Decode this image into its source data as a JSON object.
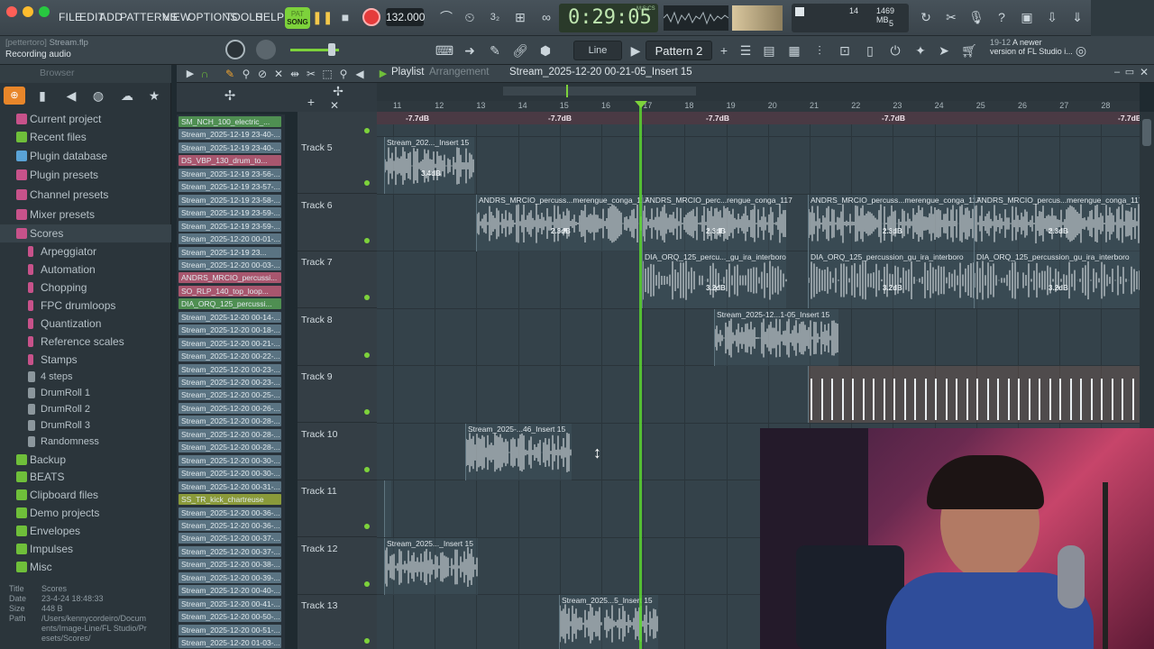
{
  "menu": [
    "FILE",
    "EDIT",
    "ADD",
    "PATTERNS",
    "VIEW",
    "OPTIONS",
    "TOOLS",
    "HELP"
  ],
  "transport": {
    "song_label": "SONG",
    "pat_label": "PAT",
    "tempo": "132.000",
    "time": "0:29:05",
    "time_units": "M:S:CS",
    "cpu_num": "14",
    "mem": "1469 MB",
    "mem_sub": "5"
  },
  "project": {
    "name": "Stream.flp",
    "owner": "[pettertoro]",
    "status": "Recording audio"
  },
  "toolbar2": {
    "snap": "Line",
    "pattern": "Pattern 2",
    "news_date": "19-12",
    "news_text": "A newer",
    "news_text2": "version of FL Studio i..."
  },
  "browser": {
    "title": "Browser",
    "items": [
      {
        "label": "Current project",
        "color": "#c7528a"
      },
      {
        "label": "Recent files",
        "color": "#6fbf3a"
      },
      {
        "label": "Plugin database",
        "color": "#5aa3d6"
      },
      {
        "label": "Plugin presets",
        "color": "#c7528a"
      },
      {
        "label": "Channel presets",
        "color": "#c7528a"
      },
      {
        "label": "Mixer presets",
        "color": "#c7528a"
      },
      {
        "label": "Scores",
        "color": "#c7528a"
      }
    ],
    "subitems": [
      "Arpeggiator",
      "Automation",
      "Chopping",
      "FPC drumloops",
      "Quantization",
      "Reference scales",
      "Stamps",
      "4 steps",
      "DrumRoll 1",
      "DrumRoll 2",
      "DrumRoll 3",
      "Randomness"
    ],
    "items2": [
      {
        "label": "Backup",
        "color": "#6fbf3a"
      },
      {
        "label": "BEATS",
        "color": "#6fbf3a"
      },
      {
        "label": "Clipboard files",
        "color": "#6fbf3a"
      },
      {
        "label": "Demo projects",
        "color": "#6fbf3a"
      },
      {
        "label": "Envelopes",
        "color": "#6fbf3a"
      },
      {
        "label": "Impulses",
        "color": "#6fbf3a"
      },
      {
        "label": "Misc",
        "color": "#6fbf3a"
      }
    ],
    "info": {
      "title_label": "Title",
      "title": "Scores",
      "date_label": "Date",
      "date": "23-4-24 18:48:33",
      "size_label": "Size",
      "size": "448 B",
      "path_label": "Path",
      "path": "/Users/kennycordeiro/Documents/Image-Line/FL Studio/Presets/Scores/"
    }
  },
  "channels": [
    {
      "name": "SM_NCH_100_electric_...",
      "color": "#4f8f52"
    },
    {
      "name": "Stream_2025-12-19 23-40-...",
      "color": "#5a7382"
    },
    {
      "name": "Stream_2025-12-19 23-40-...",
      "color": "#5a7382"
    },
    {
      "name": "DS_VBP_130_drum_to...",
      "color": "#a8566e"
    },
    {
      "name": "Stream_2025-12-19 23-56-...",
      "color": "#5a7382"
    },
    {
      "name": "Stream_2025-12-19 23-57-...",
      "color": "#5a7382"
    },
    {
      "name": "Stream_2025-12-19 23-58-...",
      "color": "#5a7382"
    },
    {
      "name": "Stream_2025-12-19 23-59-...",
      "color": "#5a7382"
    },
    {
      "name": "Stream_2025-12-19 23-59-...",
      "color": "#5a7382"
    },
    {
      "name": "Stream_2025-12-20 00-01-...",
      "color": "#5a7382"
    },
    {
      "name": "Stream_2025-12-19 23...",
      "color": "#5a7382"
    },
    {
      "name": "Stream_2025-12-20 00-03-...",
      "color": "#5a7382"
    },
    {
      "name": "ANDRS_MRCIO_percussi...",
      "color": "#a8566e"
    },
    {
      "name": "SO_RLP_140_top_loop...",
      "color": "#a8566e"
    },
    {
      "name": "DIA_ORQ_125_percussi...",
      "color": "#4f8f52"
    },
    {
      "name": "Stream_2025-12-20 00-14-...",
      "color": "#5a7382"
    },
    {
      "name": "Stream_2025-12-20 00-18-...",
      "color": "#5a7382"
    },
    {
      "name": "Stream_2025-12-20 00-21-...",
      "color": "#5a7382"
    },
    {
      "name": "Stream_2025-12-20 00-22-...",
      "color": "#5a7382"
    },
    {
      "name": "Stream_2025-12-20 00-23-...",
      "color": "#5a7382"
    },
    {
      "name": "Stream_2025-12-20 00-23-...",
      "color": "#5a7382"
    },
    {
      "name": "Stream_2025-12-20 00-25-...",
      "color": "#5a7382"
    },
    {
      "name": "Stream_2025-12-20 00-26-...",
      "color": "#5a7382"
    },
    {
      "name": "Stream_2025-12-20 00-28-...",
      "color": "#5a7382"
    },
    {
      "name": "Stream_2025-12-20 00-28-...",
      "color": "#5a7382"
    },
    {
      "name": "Stream_2025-12-20 00-28-...",
      "color": "#5a7382"
    },
    {
      "name": "Stream_2025-12-20 00-30-...",
      "color": "#5a7382"
    },
    {
      "name": "Stream_2025-12-20 00-30-...",
      "color": "#5a7382"
    },
    {
      "name": "Stream_2025-12-20 00-31-...",
      "color": "#5a7382"
    },
    {
      "name": "SS_TR_kick_chartreuse",
      "color": "#8a9a3a"
    },
    {
      "name": "Stream_2025-12-20 00-36-...",
      "color": "#5a7382"
    },
    {
      "name": "Stream_2025-12-20 00-36-...",
      "color": "#5a7382"
    },
    {
      "name": "Stream_2025-12-20 00-37-...",
      "color": "#5a7382"
    },
    {
      "name": "Stream_2025-12-20 00-37-...",
      "color": "#5a7382"
    },
    {
      "name": "Stream_2025-12-20 00-38-...",
      "color": "#5a7382"
    },
    {
      "name": "Stream_2025-12-20 00-39-...",
      "color": "#5a7382"
    },
    {
      "name": "Stream_2025-12-20 00-40-...",
      "color": "#5a7382"
    },
    {
      "name": "Stream_2025-12-20 00-41-...",
      "color": "#5a7382"
    },
    {
      "name": "Stream_2025-12-20 00-50-...",
      "color": "#5a7382"
    },
    {
      "name": "Stream_2025-12-20 00-51-...",
      "color": "#5a7382"
    },
    {
      "name": "Stream_2025-12-20 01-03-...",
      "color": "#5a7382"
    }
  ],
  "playlist": {
    "title": "Playlist",
    "subtitle": "Arrangement",
    "pattern": "Stream_2025-12-20 00-21-05_Insert 15"
  },
  "ruler": [
    "11",
    "12",
    "13",
    "14",
    "15",
    "16",
    "17",
    "18",
    "19",
    "20",
    "21",
    "22",
    "23",
    "24",
    "25",
    "26",
    "27",
    "28"
  ],
  "tracks": [
    {
      "name": "Track 5"
    },
    {
      "name": "Track 6"
    },
    {
      "name": "Track 7"
    },
    {
      "name": "Track 8"
    },
    {
      "name": "Track 9"
    },
    {
      "name": "Track 10"
    },
    {
      "name": "Track 11"
    },
    {
      "name": "Track 12"
    },
    {
      "name": "Track 13"
    }
  ],
  "automation_db": [
    "-7.7dB",
    "-7.7dB",
    "-7.7dB",
    "-7.7dB",
    "-7.7dB"
  ],
  "clips": {
    "t5": {
      "name": "Stream_202..._Insert 15",
      "db": "3.4dB"
    },
    "t6": [
      {
        "name": "ANDRS_MRCIO_percuss...merengue_conga_117",
        "db": "2.3dB"
      },
      {
        "name": "ANDRS_MRCIO_perc...rengue_conga_117",
        "db": "2.3dB"
      },
      {
        "name": "ANDRS_MRCIO_percuss...merengue_conga_117",
        "db": "2.3dB"
      },
      {
        "name": "ANDRS_MRCIO_percus...merengue_conga_117",
        "db": "2.3dB"
      }
    ],
    "t7": [
      {
        "name": "DIA_ORQ_125_percu..._gu_ira_interboro",
        "db": "3.2dB"
      },
      {
        "name": "DIA_ORQ_125_percussion_gu_ira_interboro",
        "db": "3.2dB"
      },
      {
        "name": "DIA_ORQ_125_percussion_gu_ira_interboro",
        "db": "3.2dB"
      }
    ],
    "t8": {
      "name": "Stream_2025-12...1-05_Insert 15"
    },
    "t10": {
      "name": "Stream_2025-...46_Insert 15"
    },
    "t12": {
      "name": "Stream_2025..._Insert 15"
    },
    "t13": {
      "name": "Stream_2025...5_Insert 15"
    }
  }
}
